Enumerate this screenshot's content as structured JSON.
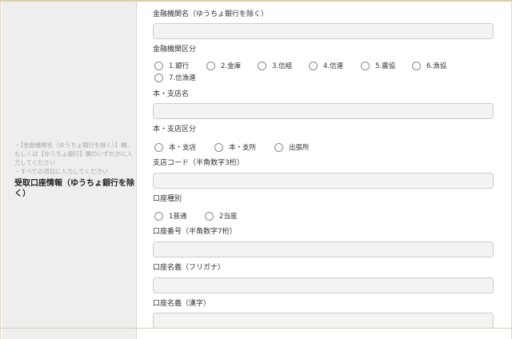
{
  "left": {
    "notes": [
      "・【金融機関名（ゆうちょ銀行を除く）】欄、もしくは【ゆうちょ銀行】欄のいずれかに入力してください",
      "・すべての項目に入力してください"
    ],
    "heading": "受取口座情報（ゆうちょ銀行を除く）"
  },
  "form": {
    "bank_name": {
      "label": "金融機関名（ゆうちょ銀行を除く）",
      "value": ""
    },
    "bank_type": {
      "label": "金融機関区分",
      "options": [
        "1.銀行",
        "2.金庫",
        "3.信組",
        "4.信連",
        "5.農協",
        "6.漁協",
        "7.信漁連"
      ]
    },
    "branch_name": {
      "label": "本・支店名",
      "value": ""
    },
    "branch_type": {
      "label": "本・支店区分",
      "options": [
        "本・支店",
        "本・支所",
        "出張所"
      ]
    },
    "branch_code": {
      "label": "支店コード（半角数字3桁）",
      "value": ""
    },
    "account_type": {
      "label": "口座種別",
      "options": [
        "1普通",
        "2当座"
      ]
    },
    "account_number": {
      "label": "口座番号（半角数字7桁）",
      "value": ""
    },
    "account_name_kana": {
      "label": "口座名義（フリガナ）",
      "value": ""
    },
    "account_name_kanji": {
      "label": "口座名義（漢字）",
      "value": ""
    }
  }
}
